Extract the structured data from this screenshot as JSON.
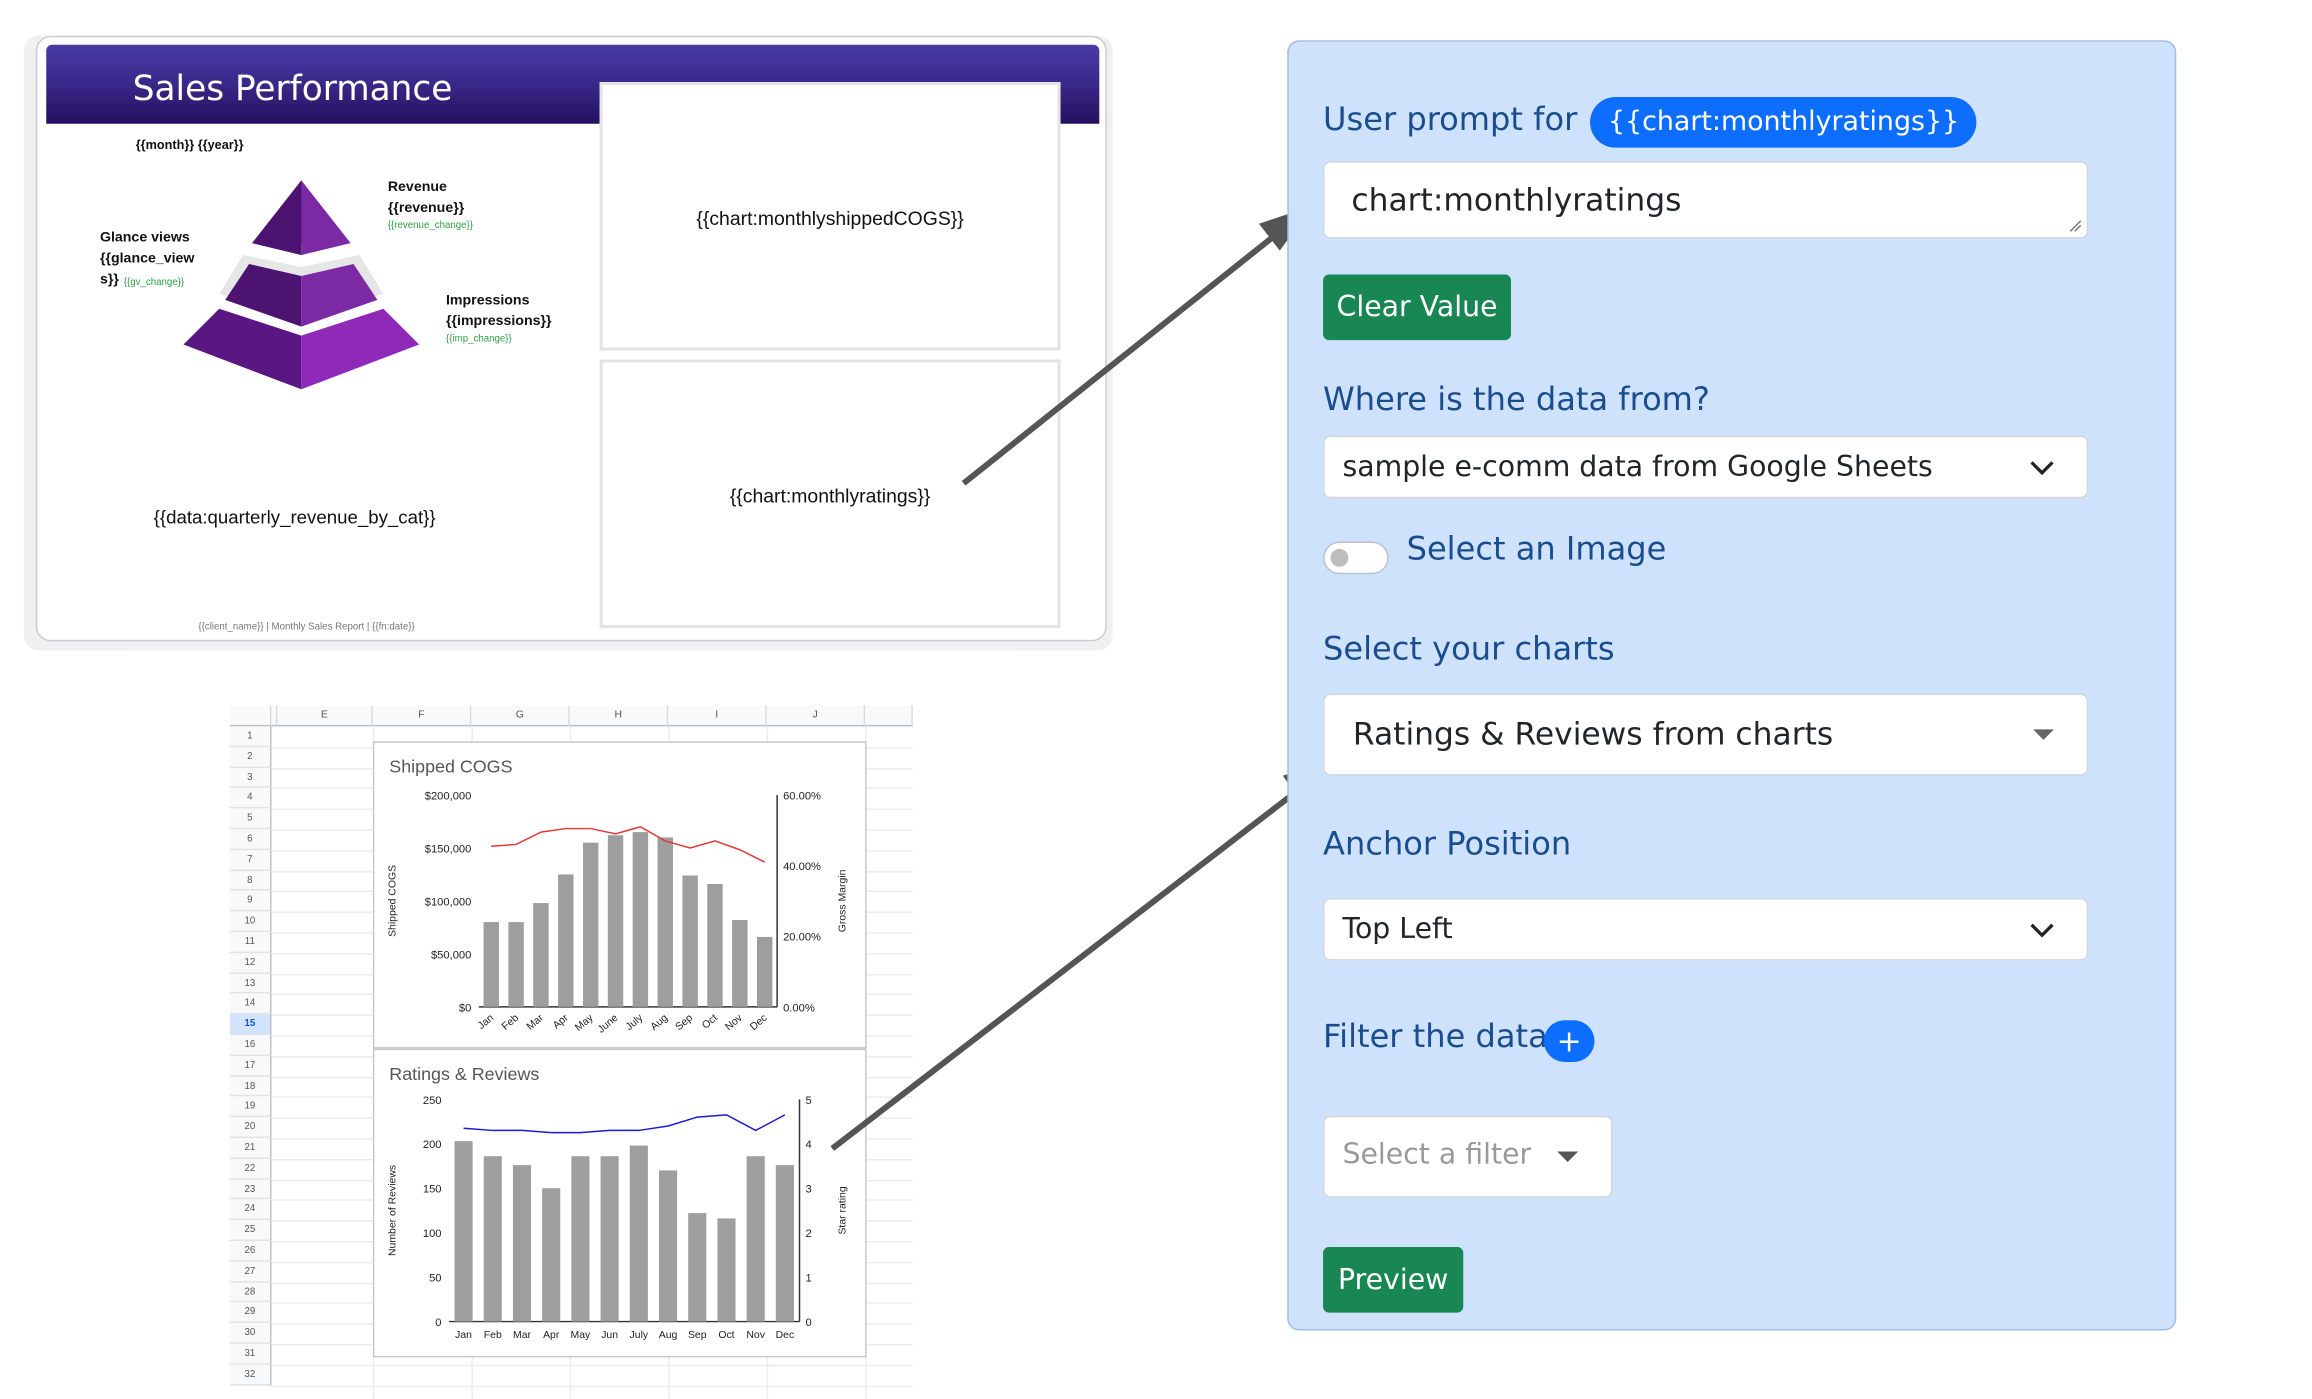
{
  "slide": {
    "title": "Sales Performance",
    "date_tag": "{{month}} {{year}}",
    "revenue_label": "Revenue",
    "revenue_tag": "{{revenue}}",
    "revenue_change_tag": "{{revenue_change}}",
    "glance_label": "Glance views",
    "glance_tag_1": "{{glance_view",
    "glance_tag_2": "s}}",
    "glance_change_tag": "{{gv_change}}",
    "impressions_label": "Impressions",
    "impressions_tag": "{{impressions}}",
    "impressions_change_tag": "{{imp_change}}",
    "quarterly_tag": "{{data:quarterly_revenue_by_cat}}",
    "chart_cogs_tag": "{{chart:monthlyshippedCOGS}}",
    "chart_ratings_tag": "{{chart:monthlyratings}}",
    "footer": "{{client_name}} | Monthly Sales Report | {{fn:date}}",
    "colors": {
      "header": "#3a2a8c",
      "pyramid": "#7a1fa2",
      "change_text": "#2ea043"
    }
  },
  "sheet": {
    "columns": [
      "E",
      "F",
      "G",
      "H",
      "I",
      "J"
    ],
    "rows": [
      "1",
      "2",
      "3",
      "4",
      "5",
      "6",
      "7",
      "8",
      "9",
      "10",
      "11",
      "12",
      "13",
      "14",
      "15",
      "16",
      "17",
      "18",
      "19",
      "20",
      "21",
      "22",
      "23",
      "24",
      "25",
      "26",
      "27",
      "28",
      "29",
      "30",
      "31",
      "32"
    ],
    "selected_row": "15"
  },
  "chart_data": [
    {
      "type": "bar",
      "title": "Shipped COGS",
      "categories": [
        "Jan",
        "Feb",
        "Mar",
        "Apr",
        "May",
        "June",
        "July",
        "Aug",
        "Sep",
        "Oct",
        "Nov",
        "Dec"
      ],
      "series": [
        {
          "name": "Shipped COGS",
          "type": "bar",
          "axis": "left",
          "values": [
            80000,
            80000,
            98000,
            125000,
            155000,
            162000,
            165000,
            160000,
            124000,
            116000,
            82000,
            66000
          ]
        },
        {
          "name": "Gross Margin",
          "type": "line",
          "axis": "right",
          "values": [
            45.5,
            46,
            49.5,
            50.5,
            50.5,
            49,
            51,
            47,
            45,
            47,
            44.5,
            41
          ]
        }
      ],
      "ylabel": "Shipped COGS",
      "y2label": "Gross Margin",
      "ylim": [
        0,
        200000
      ],
      "y2lim": [
        0,
        60
      ],
      "yticks": [
        "$0",
        "$50,000",
        "$100,000",
        "$150,000",
        "$200,000"
      ],
      "y2ticks": [
        "0.00%",
        "20.00%",
        "40.00%",
        "60.00%"
      ],
      "colors": {
        "bar": "#9e9e9e",
        "line": "#e53935"
      }
    },
    {
      "type": "bar",
      "title": "Ratings & Reviews",
      "categories": [
        "Jan",
        "Feb",
        "Mar",
        "Apr",
        "May",
        "Jun",
        "July",
        "Aug",
        "Sep",
        "Oct",
        "Nov",
        "Dec"
      ],
      "series": [
        {
          "name": "Number of Reviews",
          "type": "bar",
          "axis": "left",
          "values": [
            203,
            186,
            176,
            150,
            186,
            186,
            198,
            170,
            122,
            116,
            186,
            176
          ]
        },
        {
          "name": "Star rating",
          "type": "line",
          "axis": "right",
          "values": [
            4.35,
            4.3,
            4.3,
            4.25,
            4.25,
            4.3,
            4.3,
            4.4,
            4.6,
            4.65,
            4.3,
            4.65
          ]
        }
      ],
      "ylabel": "Number of Reviews",
      "y2label": "Star rating",
      "ylim": [
        0,
        250
      ],
      "y2lim": [
        0,
        5
      ],
      "yticks": [
        "0",
        "50",
        "100",
        "150",
        "200",
        "250"
      ],
      "y2ticks": [
        "0",
        "1",
        "2",
        "3",
        "4",
        "5"
      ],
      "colors": {
        "bar": "#9e9e9e",
        "line": "#1a1ad6"
      }
    }
  ],
  "panel": {
    "prompt_label": "User prompt for",
    "prompt_chip": "{{chart:monthlyratings}}",
    "prompt_value": "chart:monthlyratings",
    "clear_button": "Clear Value",
    "source_label": "Where is the data from?",
    "source_value": "sample e-comm data from Google Sheets",
    "image_toggle_label": "Select an Image",
    "image_toggle_on": false,
    "charts_label": "Select your charts",
    "charts_value": "Ratings & Reviews from charts",
    "anchor_label": "Anchor Position",
    "anchor_value": "Top Left",
    "filter_label": "Filter the data",
    "filter_add": "+",
    "filter_placeholder": "Select a filter",
    "preview_button": "Preview",
    "colors": {
      "panel_bg": "#cfe2fc",
      "label": "#1a4d8f",
      "chip": "#0d6efd",
      "button": "#198754"
    }
  }
}
